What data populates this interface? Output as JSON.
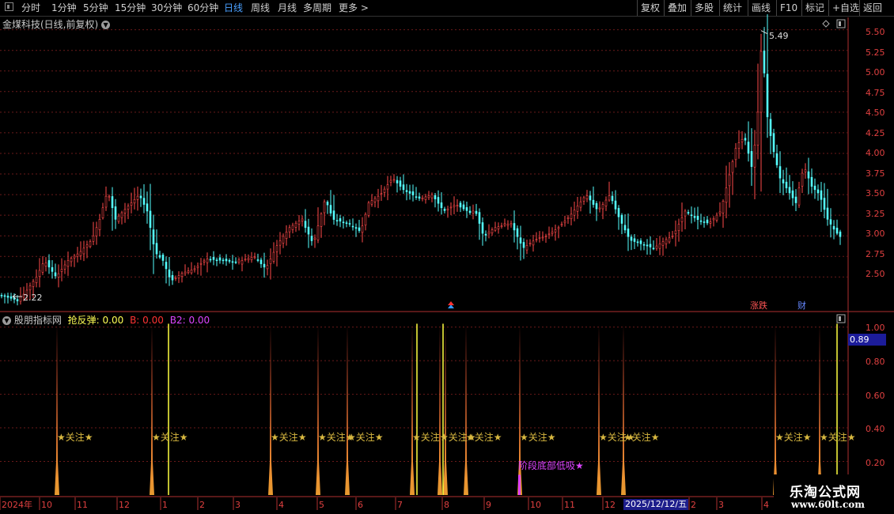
{
  "toolbar": {
    "periods": [
      "分时",
      "1分钟",
      "5分钟",
      "15分钟",
      "30分钟",
      "60分钟",
      "日线",
      "周线",
      "月线",
      "多周期",
      "更多 >"
    ],
    "active_period": "日线",
    "right_buttons": [
      "复权",
      "叠加",
      "多股",
      "统计",
      "画线",
      "F10",
      "标记",
      "+自选",
      "返回"
    ]
  },
  "main_chart": {
    "title": "金煤科技(日线,前复权)",
    "high_label": "5.49",
    "low_label": "2.22",
    "event_labels": [
      "涨跌",
      "财"
    ],
    "y_ticks": [
      "5.50",
      "5.25",
      "5.00",
      "4.75",
      "4.50",
      "4.25",
      "4.00",
      "3.75",
      "3.50",
      "3.25",
      "3.00",
      "2.75",
      "2.50"
    ]
  },
  "indicator": {
    "name": "股朋指标网",
    "series_labels": [
      {
        "label": "抢反弹: 0.00",
        "color": "#ffff55"
      },
      {
        "label": "B: 0.00",
        "color": "#ff3333"
      },
      {
        "label": "B2: 0.00",
        "color": "#dd44ff"
      }
    ],
    "signal_text": "★关注★",
    "bottom_signal_text": "阶段底部低吸★",
    "y_ticks": [
      "1.00",
      "0.80",
      "0.60",
      "0.40",
      "0.20"
    ],
    "current_value": "0.89"
  },
  "time_axis": {
    "labels": [
      "2024年",
      "10",
      "11",
      "12",
      "1",
      "2",
      "3",
      "4",
      "5",
      "6",
      "7",
      "8",
      "9",
      "10",
      "11",
      "12",
      "2025/12/12/五",
      "2",
      "3",
      "4"
    ]
  },
  "watermark": {
    "line1": "乐淘公式网",
    "line2": "www.60lt.com"
  },
  "chart_data": {
    "type": "candlestick",
    "title": "金煤科技(日线,前复权)",
    "ylim": [
      2.1,
      5.65
    ],
    "high": 5.49,
    "low": 2.22,
    "y_ticks": [
      2.5,
      2.75,
      3.0,
      3.25,
      3.5,
      3.75,
      4.0,
      4.25,
      4.5,
      4.75,
      5.0,
      5.25,
      5.5
    ],
    "close_path": [
      [
        0,
        2.28
      ],
      [
        20,
        2.22
      ],
      [
        30,
        2.3
      ],
      [
        45,
        2.5
      ],
      [
        55,
        2.7
      ],
      [
        70,
        2.5
      ],
      [
        85,
        2.7
      ],
      [
        100,
        2.8
      ],
      [
        115,
        2.95
      ],
      [
        125,
        3.2
      ],
      [
        135,
        3.55
      ],
      [
        145,
        3.2
      ],
      [
        160,
        3.35
      ],
      [
        175,
        3.5
      ],
      [
        185,
        3.3
      ],
      [
        195,
        2.8
      ],
      [
        205,
        2.7
      ],
      [
        215,
        2.45
      ],
      [
        230,
        2.55
      ],
      [
        245,
        2.6
      ],
      [
        260,
        2.72
      ],
      [
        280,
        2.7
      ],
      [
        300,
        2.68
      ],
      [
        320,
        2.75
      ],
      [
        335,
        2.6
      ],
      [
        350,
        2.9
      ],
      [
        365,
        3.1
      ],
      [
        380,
        3.2
      ],
      [
        395,
        2.9
      ],
      [
        410,
        3.45
      ],
      [
        420,
        3.2
      ],
      [
        440,
        3.15
      ],
      [
        455,
        3.05
      ],
      [
        465,
        3.4
      ],
      [
        480,
        3.5
      ],
      [
        495,
        3.7
      ],
      [
        510,
        3.55
      ],
      [
        530,
        3.45
      ],
      [
        545,
        3.5
      ],
      [
        560,
        3.3
      ],
      [
        575,
        3.38
      ],
      [
        590,
        3.3
      ],
      [
        600,
        3.3
      ],
      [
        610,
        3.0
      ],
      [
        625,
        3.1
      ],
      [
        645,
        3.15
      ],
      [
        660,
        2.85
      ],
      [
        675,
        2.95
      ],
      [
        690,
        3.0
      ],
      [
        705,
        3.1
      ],
      [
        720,
        3.25
      ],
      [
        740,
        3.5
      ],
      [
        755,
        3.3
      ],
      [
        770,
        3.5
      ],
      [
        780,
        3.25
      ],
      [
        795,
        2.95
      ],
      [
        810,
        2.9
      ],
      [
        825,
        2.85
      ],
      [
        840,
        2.95
      ],
      [
        850,
        3.0
      ],
      [
        865,
        3.3
      ],
      [
        880,
        3.2
      ],
      [
        895,
        3.15
      ],
      [
        910,
        3.3
      ],
      [
        920,
        3.7
      ],
      [
        930,
        4.1
      ],
      [
        940,
        4.2
      ],
      [
        950,
        3.8
      ],
      [
        958,
        4.6
      ],
      [
        962,
        5.45
      ],
      [
        968,
        4.5
      ],
      [
        975,
        4.1
      ],
      [
        985,
        3.7
      ],
      [
        995,
        3.55
      ],
      [
        1005,
        3.4
      ],
      [
        1015,
        3.85
      ],
      [
        1025,
        3.6
      ],
      [
        1035,
        3.5
      ],
      [
        1045,
        3.2
      ],
      [
        1055,
        3.05
      ],
      [
        1062,
        2.98
      ]
    ],
    "indicator": {
      "ylim": [
        0,
        1.05
      ],
      "y_ticks": [
        0.2,
        0.4,
        0.6,
        0.8,
        1.0
      ],
      "current_value": 0.89,
      "orange_spikes_x": [
        72,
        192,
        342,
        402,
        439,
        521,
        556,
        563,
        589,
        657,
        757,
        788,
        980,
        1036
      ],
      "yellow_spikes_x": [
        213,
        527,
        560,
        1058
      ],
      "magenta_spike_x": 657,
      "signal_x": [
        72,
        192,
        342,
        402,
        439,
        521,
        556,
        589,
        657,
        757,
        788,
        980,
        1036
      ]
    }
  }
}
